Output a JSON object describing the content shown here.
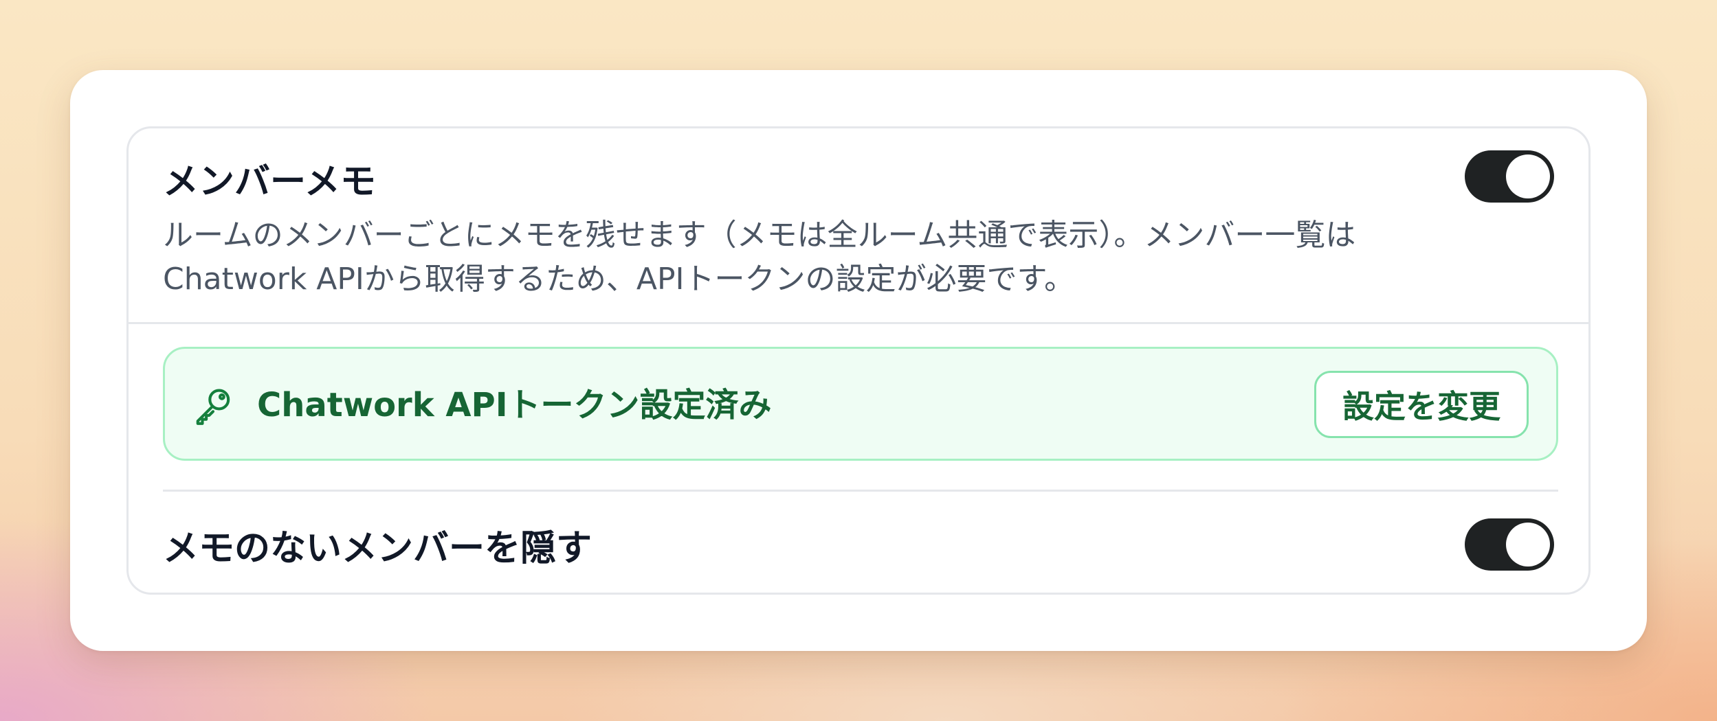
{
  "member_memo": {
    "title": "メンバーメモ",
    "description": "ルームのメンバーごとにメモを残せます（メモは全ルーム共通で表示）。メンバー一覧はChatwork APIから取得するため、APIトークンの設定が必要です。",
    "enabled": true
  },
  "api_token": {
    "icon": "key-icon",
    "status_label": "Chatwork APIトークン設定済み",
    "change_button_label": "設定を変更"
  },
  "hide_without_memo": {
    "label": "メモのないメンバーを隠す",
    "enabled": true
  },
  "colors": {
    "toggle_on": "#1f2223",
    "success_text": "#166534",
    "success_bg": "#effdf4",
    "success_border": "#a7f0c3"
  }
}
